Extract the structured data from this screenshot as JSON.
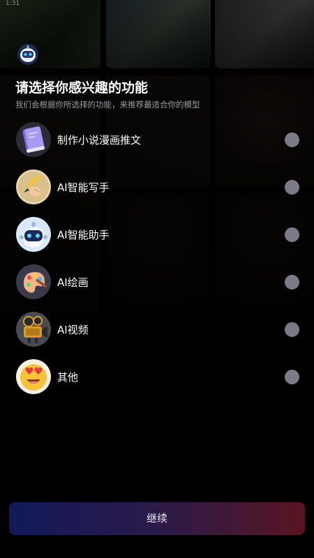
{
  "status_bar": {
    "time": "1:31"
  },
  "header": {
    "title": "请选择你感兴趣的功能",
    "subtitle": "我们会根据你所选择的功能，来推荐最适合你的模型"
  },
  "options": [
    {
      "label": "制作小说漫画推文",
      "icon": "book-icon",
      "selected": false
    },
    {
      "label": "AI智能写手",
      "icon": "pencil-hand-icon",
      "selected": false
    },
    {
      "label": "AI智能助手",
      "icon": "robot-icon",
      "selected": false
    },
    {
      "label": "AI绘画",
      "icon": "paint-palette-icon",
      "selected": false
    },
    {
      "label": "AI视频",
      "icon": "film-camera-icon",
      "selected": false
    },
    {
      "label": "其他",
      "icon": "heart-eyes-emoji-icon",
      "selected": false
    }
  ],
  "continue_button": {
    "label": "继续"
  },
  "colors": {
    "background": "#000000",
    "radio_unselected": "#7b7a86",
    "button_gradient_start": "#121a5a",
    "button_gradient_end": "#5a1422"
  }
}
